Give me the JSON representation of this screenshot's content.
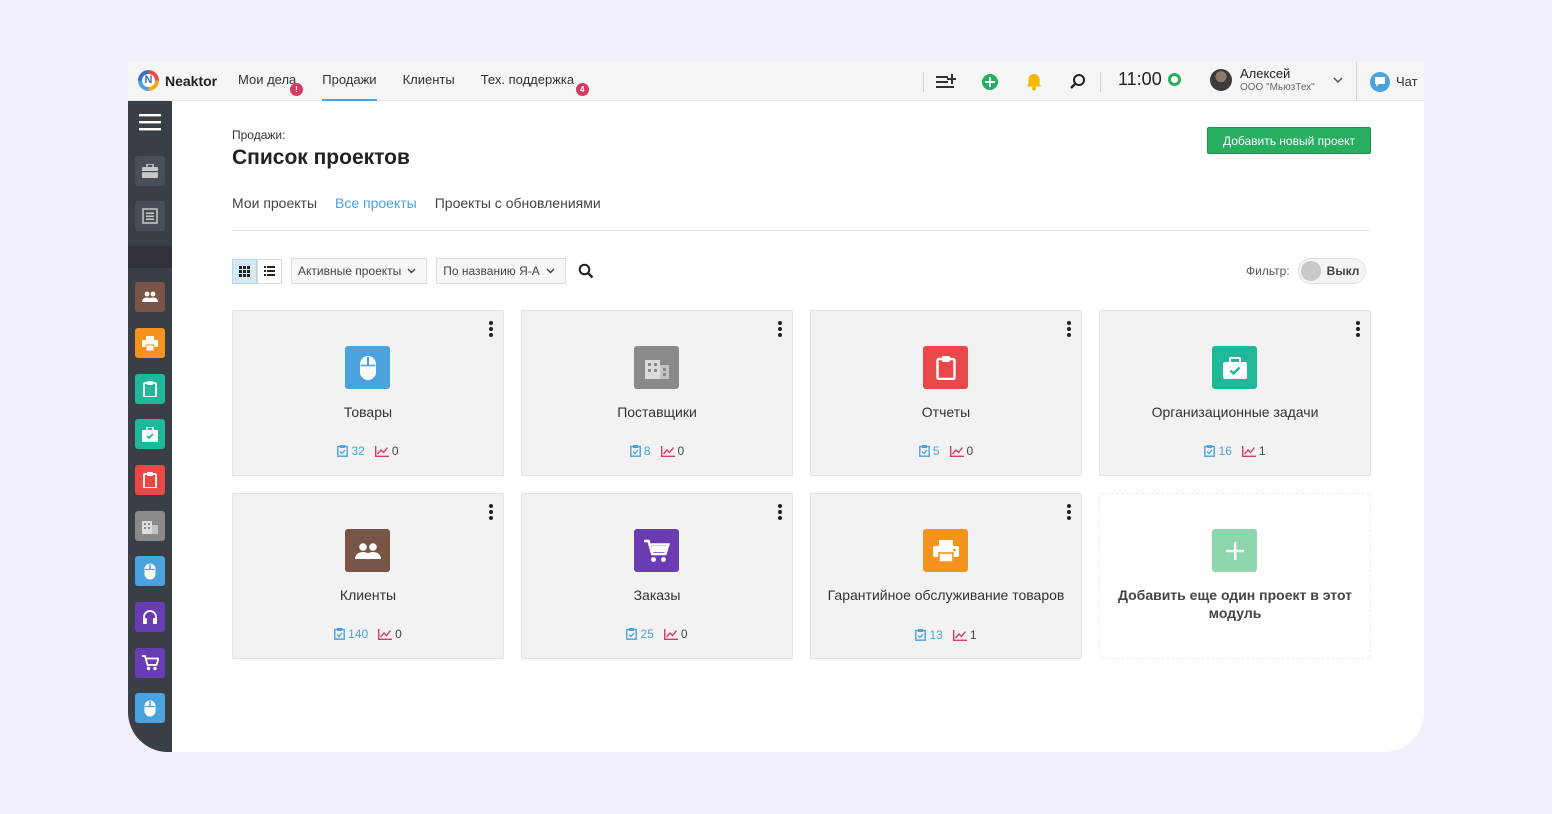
{
  "app": {
    "name": "Neaktor"
  },
  "nav": [
    {
      "label": "Мои дела",
      "badge": "!"
    },
    {
      "label": "Продажи",
      "badge": ""
    },
    {
      "label": "Клиенты",
      "badge": ""
    },
    {
      "label": "Тех. поддержка",
      "badge": "4"
    }
  ],
  "header": {
    "time": "11:00",
    "user_name": "Алексей",
    "user_org": "ООО \"МьюзТех\"",
    "chat_label": "Чат"
  },
  "page": {
    "breadcrumb": "Продажи:",
    "title": "Список проектов",
    "add_button": "Добавить новый проект"
  },
  "tabs": [
    {
      "label": "Мои проекты"
    },
    {
      "label": "Все проекты"
    },
    {
      "label": "Проекты с обновлениями"
    }
  ],
  "toolbar": {
    "status_select": "Активные проекты",
    "sort_select": "По названию Я-А",
    "filter_label": "Фильтр:",
    "filter_state": "Выкл"
  },
  "projects": [
    {
      "title": "Товары",
      "tasks": "32",
      "updates": "0",
      "icon": "mouse-icon",
      "color": "#4aa3df"
    },
    {
      "title": "Поставщики",
      "tasks": "8",
      "updates": "0",
      "icon": "building-icon",
      "color": "#8a8a8a"
    },
    {
      "title": "Отчеты",
      "tasks": "5",
      "updates": "0",
      "icon": "clipboard-icon",
      "color": "#e94848"
    },
    {
      "title": "Организационные задачи",
      "tasks": "16",
      "updates": "1",
      "icon": "briefcase-check-icon",
      "color": "#1fb89b"
    },
    {
      "title": "Клиенты",
      "tasks": "140",
      "updates": "0",
      "icon": "people-icon",
      "color": "#795548"
    },
    {
      "title": "Заказы",
      "tasks": "25",
      "updates": "0",
      "icon": "cart-icon",
      "color": "#6a3cb3"
    },
    {
      "title": "Гарантийное обслуживание товаров",
      "tasks": "13",
      "updates": "1",
      "icon": "printer-icon",
      "color": "#f5931f"
    }
  ],
  "add_card": {
    "title": "Добавить еще один проект в этот модуль"
  },
  "sidebar": [
    {
      "icon": "menu-icon"
    },
    {
      "icon": "briefcase-icon"
    },
    {
      "icon": "list-icon"
    },
    {
      "icon": "people-icon",
      "color": "#795548"
    },
    {
      "icon": "printer-icon",
      "color": "#f5931f"
    },
    {
      "icon": "clipboard-icon",
      "color": "#1fb89b"
    },
    {
      "icon": "briefcase-check-icon",
      "color": "#1fb89b"
    },
    {
      "icon": "clipboard-icon",
      "color": "#e94848"
    },
    {
      "icon": "building-icon",
      "color": "#8a8a8a"
    },
    {
      "icon": "mouse-icon",
      "color": "#4aa3df"
    },
    {
      "icon": "headset-icon",
      "color": "#6a3cb3"
    },
    {
      "icon": "cart-icon",
      "color": "#6a3cb3"
    },
    {
      "icon": "mouse-icon",
      "color": "#4aa3df"
    }
  ],
  "colors": {
    "accent": "#4aa3df",
    "primary_button": "#27ae60",
    "badge": "#d63a63",
    "sidebar": "#3a3e45"
  }
}
